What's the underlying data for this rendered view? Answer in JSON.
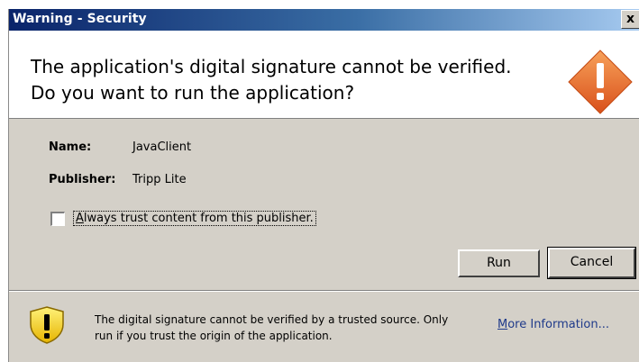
{
  "window": {
    "title": "Warning - Security",
    "close_glyph": "x"
  },
  "header": {
    "headline": "The application's digital signature cannot be verified.\nDo you want to run the application?",
    "icon": "warning-diamond-icon",
    "icon_color": "#e8641e"
  },
  "details": {
    "name_label": "Name:",
    "name_value": "JavaClient",
    "publisher_label": "Publisher:",
    "publisher_value": "Tripp Lite"
  },
  "trust_checkbox": {
    "label_access_key": "A",
    "label_rest": "lways trust content from this publisher.",
    "checked": false
  },
  "buttons": {
    "run": "Run",
    "cancel": "Cancel"
  },
  "footer": {
    "icon": "shield-warning-icon",
    "message": "The digital signature cannot be verified by a trusted source.  Only\nrun if you trust the origin of the application.",
    "more_info_access_key": "M",
    "more_info_rest": "ore Information..."
  }
}
